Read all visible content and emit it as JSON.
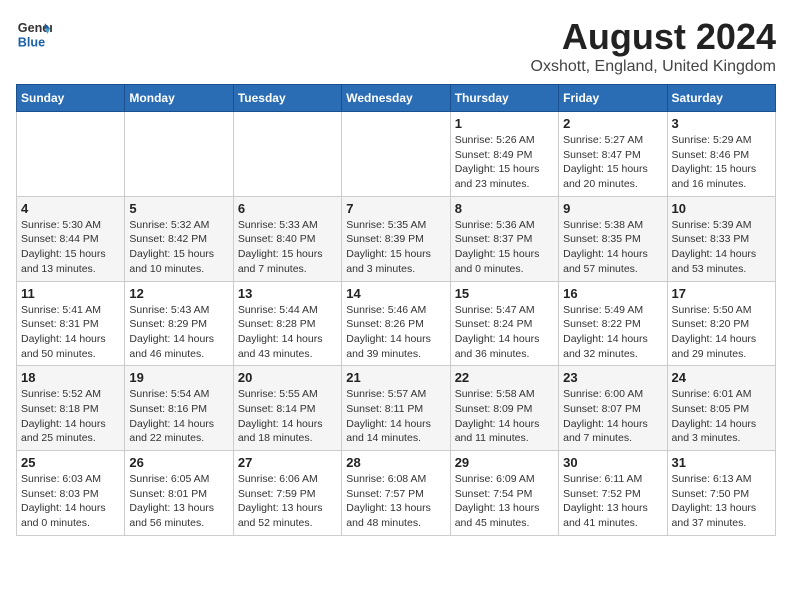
{
  "header": {
    "logo_general": "General",
    "logo_blue": "Blue",
    "title": "August 2024",
    "subtitle": "Oxshott, England, United Kingdom"
  },
  "weekdays": [
    "Sunday",
    "Monday",
    "Tuesday",
    "Wednesday",
    "Thursday",
    "Friday",
    "Saturday"
  ],
  "weeks": [
    [
      {
        "day": "",
        "info": ""
      },
      {
        "day": "",
        "info": ""
      },
      {
        "day": "",
        "info": ""
      },
      {
        "day": "",
        "info": ""
      },
      {
        "day": "1",
        "info": "Sunrise: 5:26 AM\nSunset: 8:49 PM\nDaylight: 15 hours\nand 23 minutes."
      },
      {
        "day": "2",
        "info": "Sunrise: 5:27 AM\nSunset: 8:47 PM\nDaylight: 15 hours\nand 20 minutes."
      },
      {
        "day": "3",
        "info": "Sunrise: 5:29 AM\nSunset: 8:46 PM\nDaylight: 15 hours\nand 16 minutes."
      }
    ],
    [
      {
        "day": "4",
        "info": "Sunrise: 5:30 AM\nSunset: 8:44 PM\nDaylight: 15 hours\nand 13 minutes."
      },
      {
        "day": "5",
        "info": "Sunrise: 5:32 AM\nSunset: 8:42 PM\nDaylight: 15 hours\nand 10 minutes."
      },
      {
        "day": "6",
        "info": "Sunrise: 5:33 AM\nSunset: 8:40 PM\nDaylight: 15 hours\nand 7 minutes."
      },
      {
        "day": "7",
        "info": "Sunrise: 5:35 AM\nSunset: 8:39 PM\nDaylight: 15 hours\nand 3 minutes."
      },
      {
        "day": "8",
        "info": "Sunrise: 5:36 AM\nSunset: 8:37 PM\nDaylight: 15 hours\nand 0 minutes."
      },
      {
        "day": "9",
        "info": "Sunrise: 5:38 AM\nSunset: 8:35 PM\nDaylight: 14 hours\nand 57 minutes."
      },
      {
        "day": "10",
        "info": "Sunrise: 5:39 AM\nSunset: 8:33 PM\nDaylight: 14 hours\nand 53 minutes."
      }
    ],
    [
      {
        "day": "11",
        "info": "Sunrise: 5:41 AM\nSunset: 8:31 PM\nDaylight: 14 hours\nand 50 minutes."
      },
      {
        "day": "12",
        "info": "Sunrise: 5:43 AM\nSunset: 8:29 PM\nDaylight: 14 hours\nand 46 minutes."
      },
      {
        "day": "13",
        "info": "Sunrise: 5:44 AM\nSunset: 8:28 PM\nDaylight: 14 hours\nand 43 minutes."
      },
      {
        "day": "14",
        "info": "Sunrise: 5:46 AM\nSunset: 8:26 PM\nDaylight: 14 hours\nand 39 minutes."
      },
      {
        "day": "15",
        "info": "Sunrise: 5:47 AM\nSunset: 8:24 PM\nDaylight: 14 hours\nand 36 minutes."
      },
      {
        "day": "16",
        "info": "Sunrise: 5:49 AM\nSunset: 8:22 PM\nDaylight: 14 hours\nand 32 minutes."
      },
      {
        "day": "17",
        "info": "Sunrise: 5:50 AM\nSunset: 8:20 PM\nDaylight: 14 hours\nand 29 minutes."
      }
    ],
    [
      {
        "day": "18",
        "info": "Sunrise: 5:52 AM\nSunset: 8:18 PM\nDaylight: 14 hours\nand 25 minutes."
      },
      {
        "day": "19",
        "info": "Sunrise: 5:54 AM\nSunset: 8:16 PM\nDaylight: 14 hours\nand 22 minutes."
      },
      {
        "day": "20",
        "info": "Sunrise: 5:55 AM\nSunset: 8:14 PM\nDaylight: 14 hours\nand 18 minutes."
      },
      {
        "day": "21",
        "info": "Sunrise: 5:57 AM\nSunset: 8:11 PM\nDaylight: 14 hours\nand 14 minutes."
      },
      {
        "day": "22",
        "info": "Sunrise: 5:58 AM\nSunset: 8:09 PM\nDaylight: 14 hours\nand 11 minutes."
      },
      {
        "day": "23",
        "info": "Sunrise: 6:00 AM\nSunset: 8:07 PM\nDaylight: 14 hours\nand 7 minutes."
      },
      {
        "day": "24",
        "info": "Sunrise: 6:01 AM\nSunset: 8:05 PM\nDaylight: 14 hours\nand 3 minutes."
      }
    ],
    [
      {
        "day": "25",
        "info": "Sunrise: 6:03 AM\nSunset: 8:03 PM\nDaylight: 14 hours\nand 0 minutes."
      },
      {
        "day": "26",
        "info": "Sunrise: 6:05 AM\nSunset: 8:01 PM\nDaylight: 13 hours\nand 56 minutes."
      },
      {
        "day": "27",
        "info": "Sunrise: 6:06 AM\nSunset: 7:59 PM\nDaylight: 13 hours\nand 52 minutes."
      },
      {
        "day": "28",
        "info": "Sunrise: 6:08 AM\nSunset: 7:57 PM\nDaylight: 13 hours\nand 48 minutes."
      },
      {
        "day": "29",
        "info": "Sunrise: 6:09 AM\nSunset: 7:54 PM\nDaylight: 13 hours\nand 45 minutes."
      },
      {
        "day": "30",
        "info": "Sunrise: 6:11 AM\nSunset: 7:52 PM\nDaylight: 13 hours\nand 41 minutes."
      },
      {
        "day": "31",
        "info": "Sunrise: 6:13 AM\nSunset: 7:50 PM\nDaylight: 13 hours\nand 37 minutes."
      }
    ]
  ]
}
